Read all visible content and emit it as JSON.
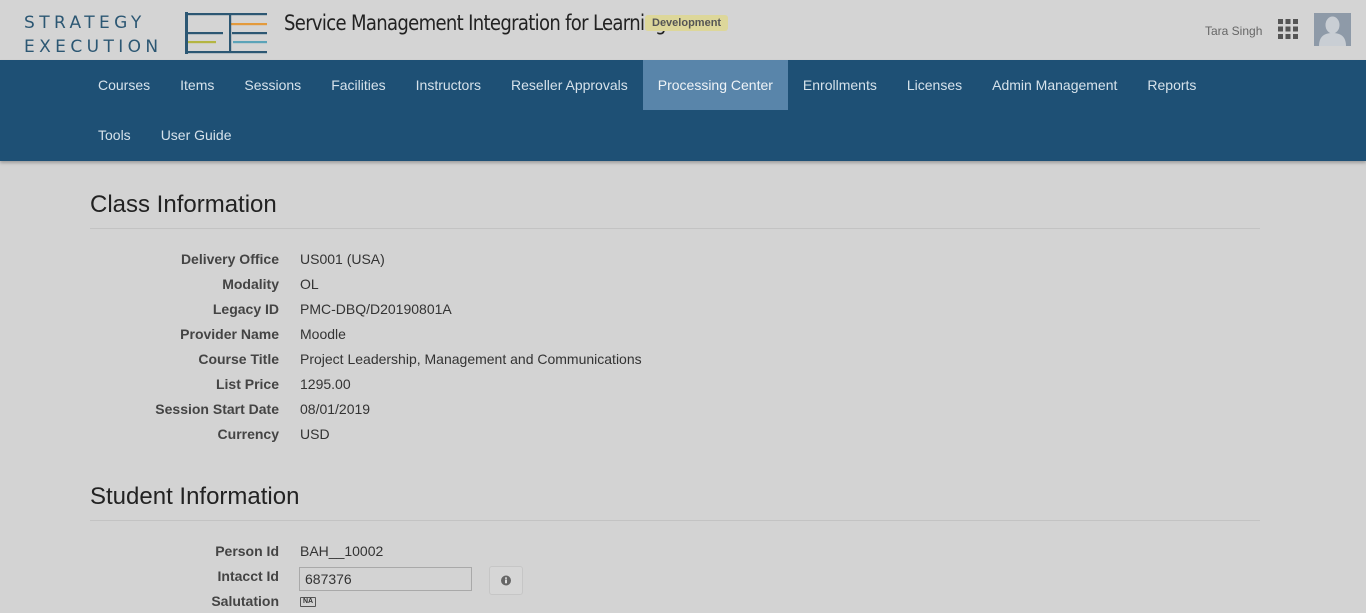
{
  "brand": {
    "logo_line1": "STRATEGY",
    "logo_line2": "EXECUTION",
    "app_title": "Service Management Integration for Learning",
    "environment": "Development",
    "colors": {
      "primary": "#1e5075",
      "active_nav": "#5985aa",
      "logo_orange": "#e39a3c",
      "logo_olive": "#b4b542",
      "logo_teal": "#5ba3b8",
      "logo_navy": "#2c5773"
    }
  },
  "user": {
    "name": "Tara Singh",
    "apps_icon": "grid-icon",
    "avatar_icon": "user-silhouette-icon"
  },
  "nav": {
    "row1": [
      {
        "label": "Courses",
        "active": false
      },
      {
        "label": "Items",
        "active": false
      },
      {
        "label": "Sessions",
        "active": false
      },
      {
        "label": "Facilities",
        "active": false
      },
      {
        "label": "Instructors",
        "active": false
      },
      {
        "label": "Reseller Approvals",
        "active": false
      },
      {
        "label": "Processing Center",
        "active": true
      },
      {
        "label": "Enrollments",
        "active": false
      },
      {
        "label": "Licenses",
        "active": false
      },
      {
        "label": "Admin Management",
        "active": false
      },
      {
        "label": "Reports",
        "active": false
      }
    ],
    "row2": [
      {
        "label": "Tools",
        "active": false
      },
      {
        "label": "User Guide",
        "active": false
      }
    ]
  },
  "class_info": {
    "title": "Class Information",
    "fields": [
      {
        "label": "Delivery Office",
        "value": "US001 (USA)"
      },
      {
        "label": "Modality",
        "value": "OL"
      },
      {
        "label": "Legacy ID",
        "value": "PMC-DBQ/D20190801A"
      },
      {
        "label": "Provider Name",
        "value": "Moodle"
      },
      {
        "label": "Course Title",
        "value": "Project Leadership, Management and Communications"
      },
      {
        "label": "List Price",
        "value": "1295.00"
      },
      {
        "label": "Session Start Date",
        "value": "08/01/2019"
      },
      {
        "label": "Currency",
        "value": "USD"
      }
    ]
  },
  "student_info": {
    "title": "Student Information",
    "person_id": {
      "label": "Person Id",
      "value": "BAH__10002"
    },
    "intacct_id": {
      "label": "Intacct Id",
      "value": "687376",
      "info_icon": "info-icon"
    },
    "salutation": {
      "label": "Salutation",
      "badge": "NA"
    }
  }
}
